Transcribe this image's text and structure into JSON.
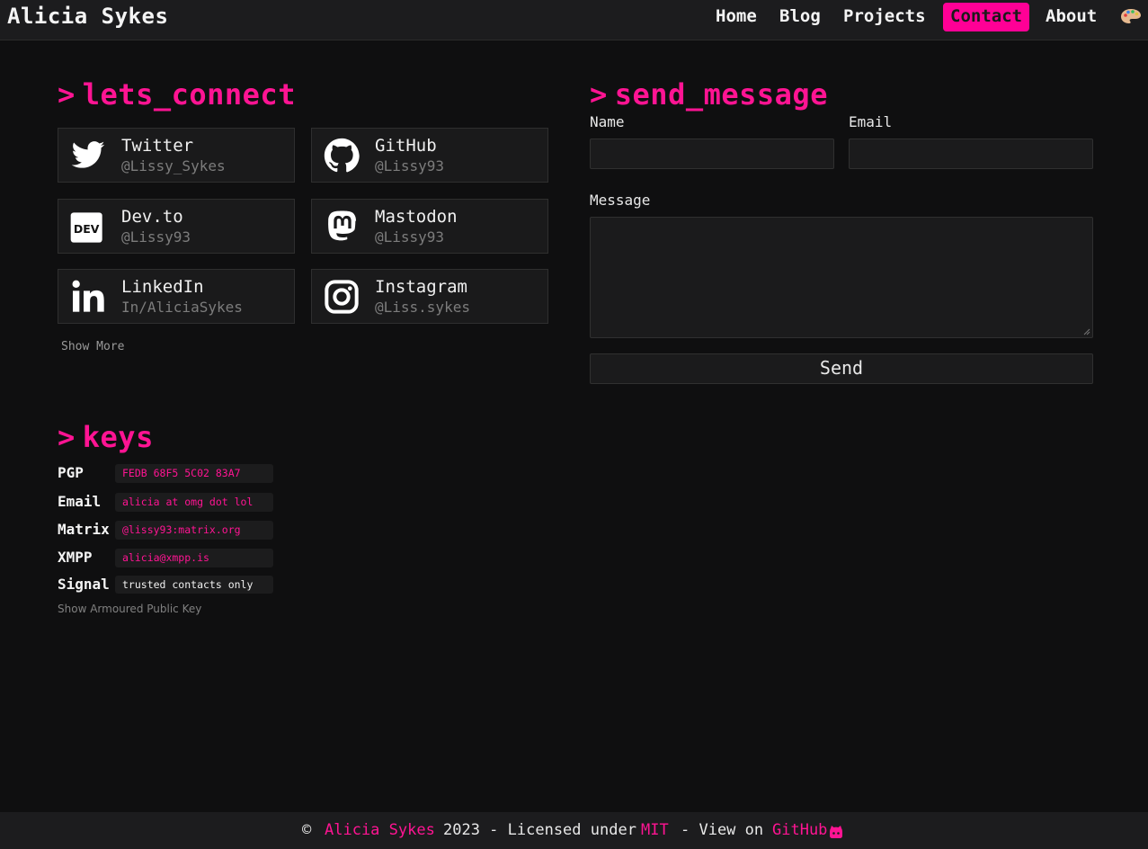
{
  "header": {
    "brand": "Alicia Sykes",
    "nav": [
      "Home",
      "Blog",
      "Projects",
      "Contact",
      "About"
    ],
    "active": "Contact"
  },
  "lets_connect": {
    "prompt": ">",
    "title": "lets_connect",
    "cards": [
      {
        "name": "Twitter",
        "handle": "@Lissy_Sykes",
        "icon": "twitter-icon"
      },
      {
        "name": "GitHub",
        "handle": "@Lissy93",
        "icon": "github-icon"
      },
      {
        "name": "Dev.to",
        "handle": "@Lissy93",
        "icon": "devto-icon"
      },
      {
        "name": "Mastodon",
        "handle": "@Lissy93",
        "icon": "mastodon-icon"
      },
      {
        "name": "LinkedIn",
        "handle": "In/AliciaSykes",
        "icon": "linkedin-icon"
      },
      {
        "name": "Instagram",
        "handle": "@Liss.sykes",
        "icon": "instagram-icon"
      }
    ],
    "show_more": "Show More"
  },
  "keys": {
    "prompt": ">",
    "title": "keys",
    "rows": [
      {
        "label": "PGP",
        "value": "FEDB 68F5 5C02 83A7"
      },
      {
        "label": "Email",
        "value": "alicia at omg dot lol"
      },
      {
        "label": "Matrix",
        "value": "@lissy93:matrix.org"
      },
      {
        "label": "XMPP",
        "value": "alicia@xmpp.is"
      },
      {
        "label": "Signal",
        "value": "trusted contacts only"
      }
    ],
    "armoured": "Show Armoured Public Key"
  },
  "send_message": {
    "prompt": ">",
    "title": "send_message",
    "name_label": "Name",
    "email_label": "Email",
    "message_label": "Message",
    "send": "Send"
  },
  "footer": {
    "copy": "©",
    "author": "Alicia Sykes",
    "mid": "2023 - Licensed under",
    "license": "MIT",
    "view": "- View on",
    "repo": "GitHub"
  },
  "colors": {
    "accent": "#ff1493",
    "nav_active": "#ff0096",
    "background": "#0f0f10",
    "panel": "#1c1c1e"
  }
}
